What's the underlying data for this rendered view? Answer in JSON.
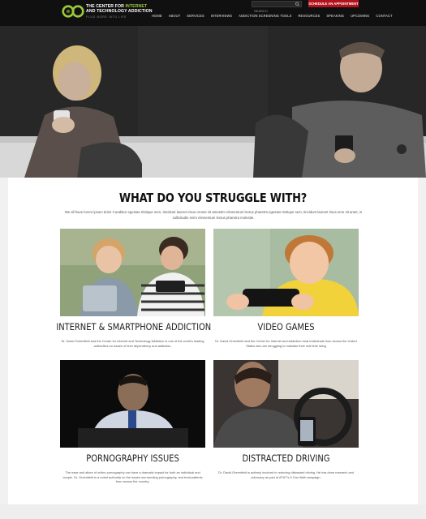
{
  "header": {
    "logo": {
      "line1_prefix": "THE CENTER FOR ",
      "line1_accent": "INTERNET",
      "line2": "AND TECHNOLOGY ADDICTION",
      "tagline": "PLUG MORE INTO LIFE"
    },
    "search": {
      "placeholder": "SEARCH"
    },
    "cta_label": "SCHEDULE AN APPOINTMENT",
    "nav": [
      "HOME",
      "ABOUT",
      "SERVICES",
      "INTERVIEWS",
      "ADDICTION SCREENING TOOLS",
      "RESOURCES",
      "SPEAKING",
      "UPCOMING",
      "CONTACT"
    ]
  },
  "hero": {
    "icon": "hero-photo-couple-on-phones"
  },
  "main": {
    "headline": "WHAT DO YOU STRUGGLE WITH?",
    "intro": "We all have lorem ipsum dolor Curabitur egestas tristique sem, tincidunt laoreet risus ornare sit ameetim elementum lectus pharetra egestas tristique sem, tincidunt laoreet risus ome sit amet, in sollicitudin enim elementum lectus pharetra molestie.",
    "cards": [
      {
        "title": "INTERNET & SMARTPHONE ADDICTION",
        "desc": "Dr. David Greenfield and the Center for Internet and Technology Addiction is one of the world's leading authorities on issues of tech dependency and addiction."
      },
      {
        "title": "VIDEO GAMES",
        "desc": "Dr. David Greenfield and the Center for Internet and Addiction treat individuals from across the United States who are struggling to maintain their real time living"
      },
      {
        "title": "PORNOGRAPHY ISSUES",
        "desc": "The ease and allure of online pornography can have a dramatic impact for both an individual and couple. Dr. Greenfield is a noted authority on the issues surrounding pornography, and treat patients from across the country."
      },
      {
        "title": "DISTRACTED DRIVING",
        "desc": "Dr. David Greenfield is actively involved in reducing distracted driving. He has done research and advocacy as part of AT&T's It Can Wait campaign."
      }
    ]
  },
  "colors": {
    "accent_green": "#9cc93a",
    "cta_red": "#b3121d",
    "header_bg": "#101010"
  }
}
